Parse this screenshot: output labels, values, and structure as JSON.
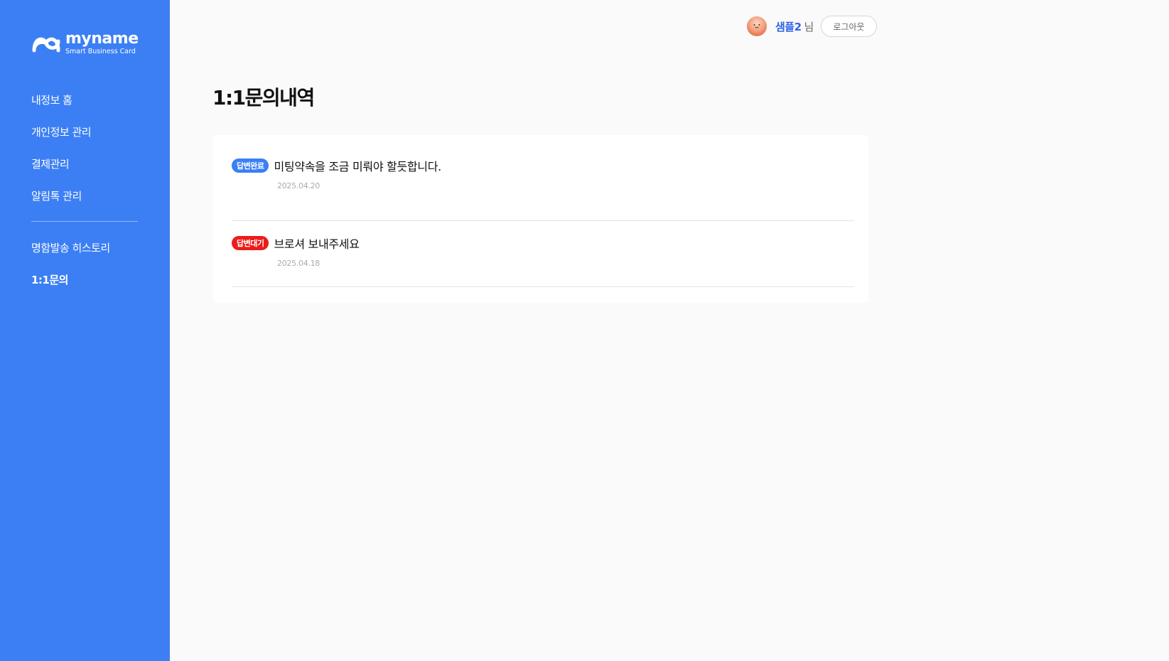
{
  "brand": {
    "name": "myname",
    "tagline": "Smart Business Card",
    "logo_icon": "infinity-m-logo-icon"
  },
  "sidebar": {
    "items": [
      {
        "label": "내정보 홈",
        "active": false
      },
      {
        "label": "개인정보 관리",
        "active": false
      },
      {
        "label": "결제관리",
        "active": false
      },
      {
        "label": "알림톡 관리",
        "active": false
      },
      {
        "label": "명함발송 히스토리",
        "active": false
      },
      {
        "label": "1:1문의",
        "active": true
      }
    ]
  },
  "header": {
    "avatar_icon": "avatar-face-icon",
    "user_name": "샘플2",
    "user_suffix": "님",
    "logout_label": "로그아웃"
  },
  "main": {
    "title": "1:1문의내역",
    "inquiries": [
      {
        "status": "답변완료",
        "status_type": "done",
        "title": "미팅약속을 조금 미뤄야 할듯합니다.",
        "date": "2025.04.20"
      },
      {
        "status": "답변대기",
        "status_type": "wait",
        "title": "브로셔 보내주세요",
        "date": "2025.04.18"
      }
    ]
  },
  "colors": {
    "sidebar_bg": "#3c7ff4",
    "accent_blue": "#2e64e6",
    "status_done": "#3c7ff4",
    "status_wait": "#ee1b1b",
    "page_bg": "#fafafa"
  }
}
